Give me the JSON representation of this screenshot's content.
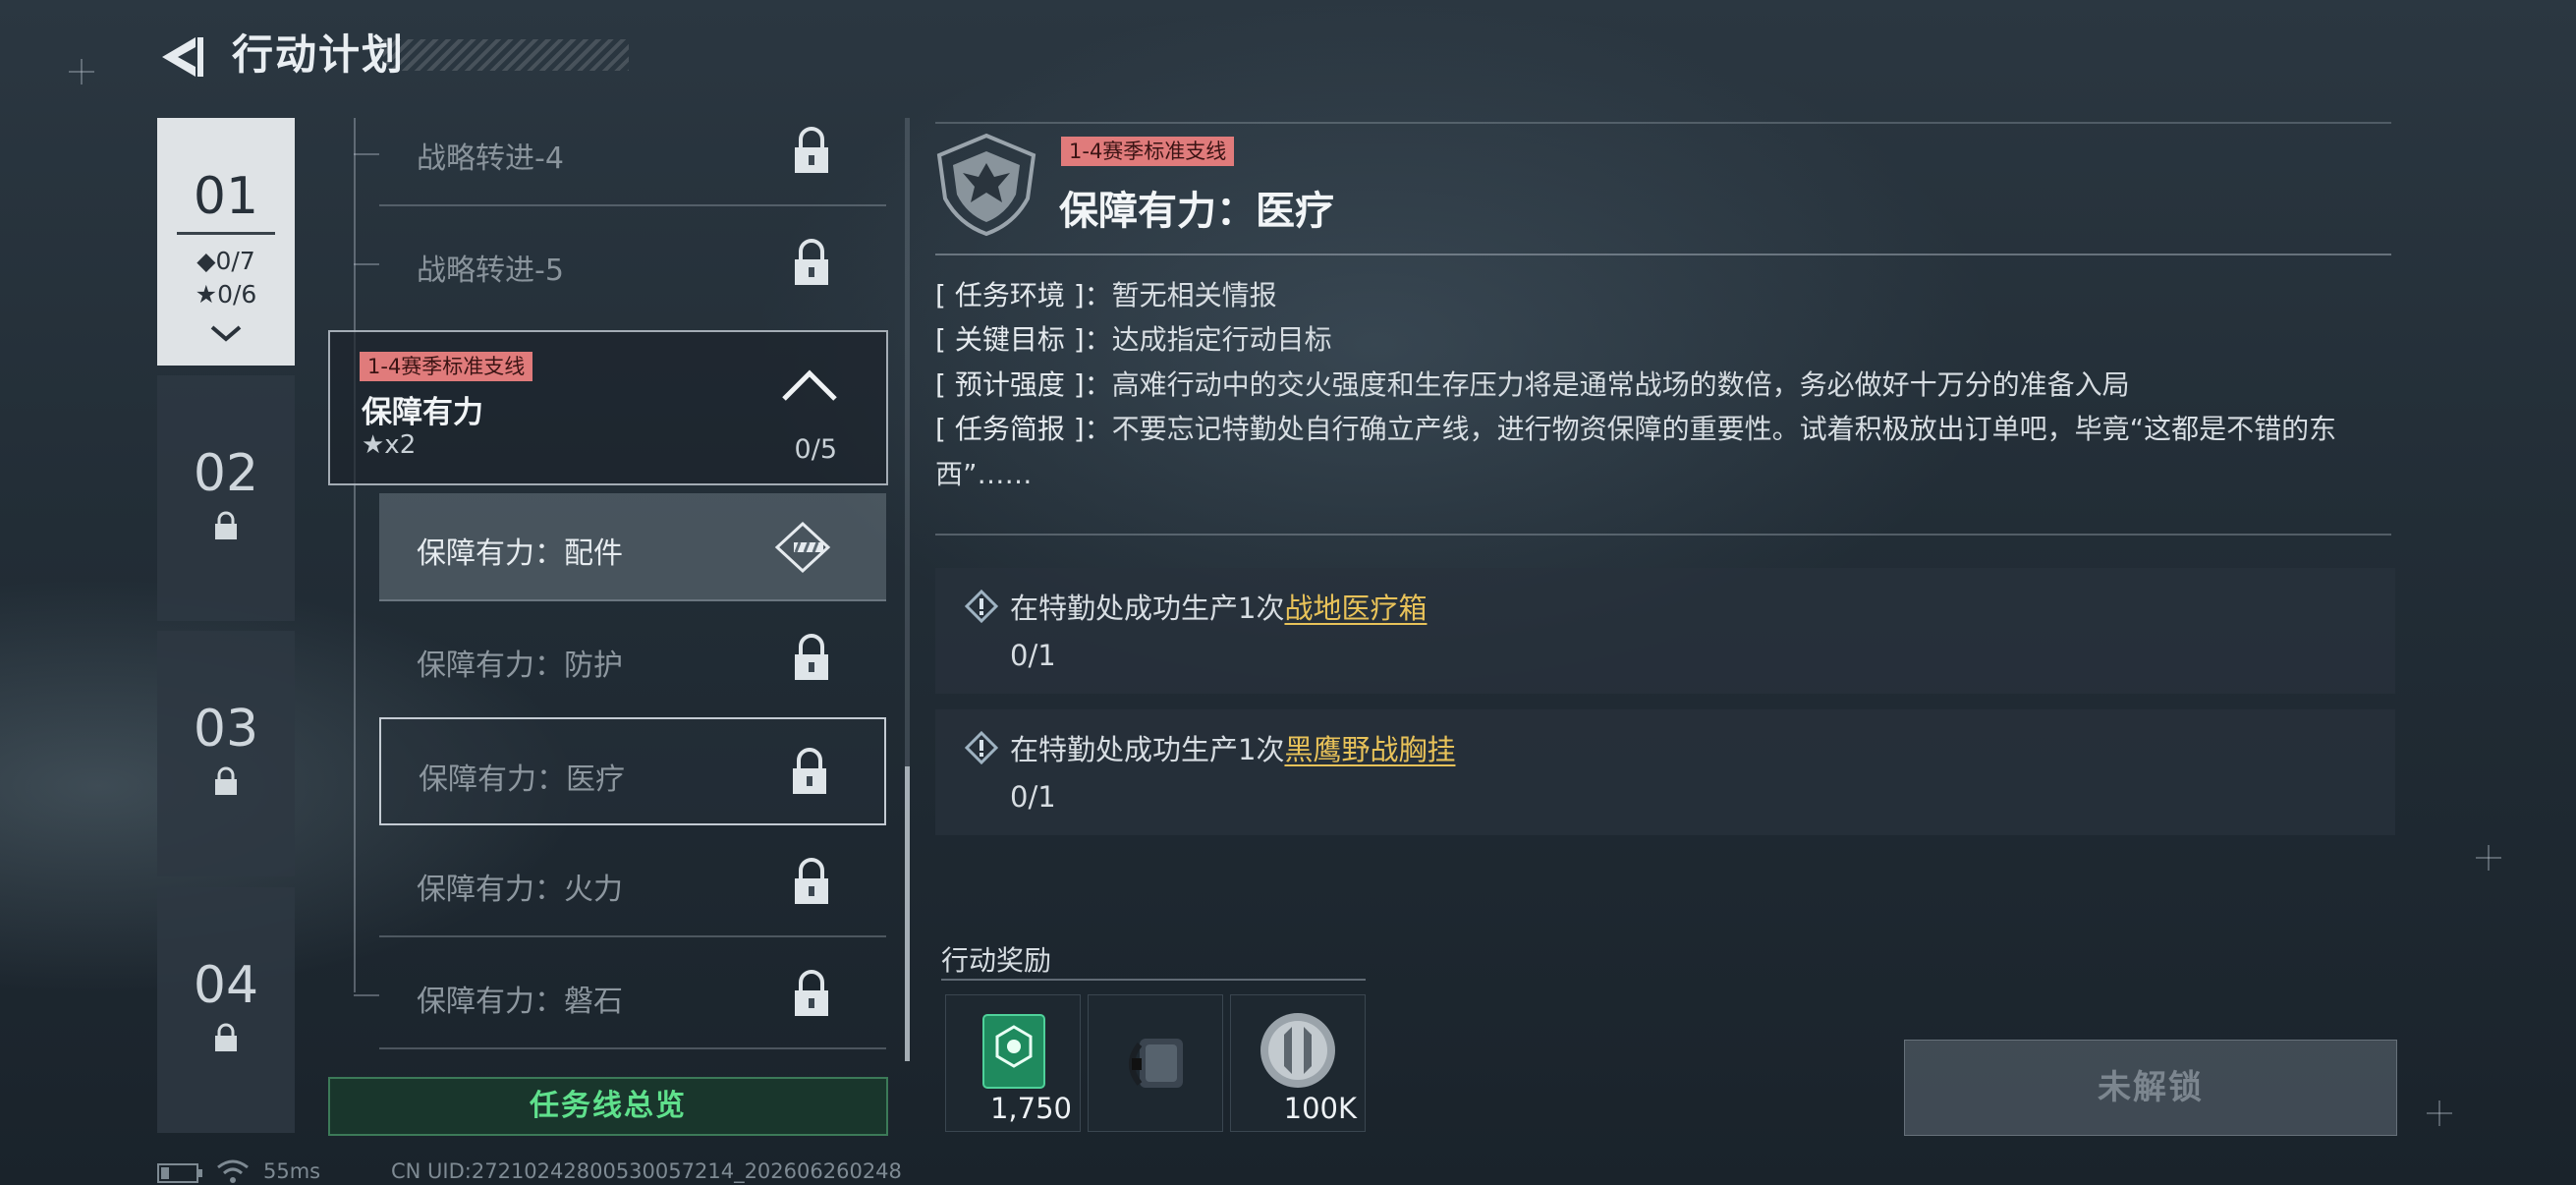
{
  "header": {
    "title": "行动计划"
  },
  "chapters": [
    {
      "num": "01",
      "diamond_stat": "◆0/7",
      "star_stat": "★0/6"
    },
    {
      "num": "02"
    },
    {
      "num": "03"
    },
    {
      "num": "04"
    }
  ],
  "missions_above": [
    {
      "label": "战略转进-4"
    },
    {
      "label": "战略转进-5"
    }
  ],
  "group": {
    "badge": "1-4赛季标准支线",
    "name": "保障有力",
    "stars": "★x2",
    "progress": "0/5"
  },
  "missions": [
    {
      "label": "保障有力：配件"
    },
    {
      "label": "保障有力：防护"
    },
    {
      "label": "保障有力：医疗"
    },
    {
      "label": "保障有力：火力"
    },
    {
      "label": "保障有力：磐石"
    }
  ],
  "overview_button": "任务线总览",
  "detail": {
    "badge": "1-4赛季标准支线",
    "title": "保障有力：医疗",
    "env_key": "[ 任务环境 ]：",
    "env_val": "暂无相关情报",
    "goal_key": "[ 关键目标 ]：",
    "goal_val": "达成指定行动目标",
    "intensity_key": "[ 预计强度 ]：",
    "intensity_val": "高难行动中的交火强度和生存压力将是通常战场的数倍，务必做好十万分的准备入局",
    "brief_key": "[ 任务简报 ]：",
    "brief_val": "不要忘记特勤处自行确立产线，进行物资保障的重要性。试着积极放出订单吧，毕竟“这都是不错的东西”……"
  },
  "objectives": [
    {
      "text": "在特勤处成功生产1次",
      "highlight": "战地医疗箱",
      "progress": "0/1"
    },
    {
      "text": "在特勤处成功生产1次",
      "highlight": "黑鹰野战胸挂",
      "progress": "0/1"
    }
  ],
  "rewards": {
    "title": "行动奖励",
    "items": [
      {
        "icon": "green-supply-card-icon",
        "count": "1,750"
      },
      {
        "icon": "gear-accessory-icon",
        "count": ""
      },
      {
        "icon": "silver-coin-icon",
        "count": "100K"
      }
    ]
  },
  "unlock_button": "未解锁",
  "status": {
    "ping": "55ms",
    "uid": "CN UID:27210242800530057214_202606260248"
  },
  "colors": {
    "badge": "#e07b7b",
    "highlight": "#e8c259",
    "overview_green": "#5fe08c"
  }
}
